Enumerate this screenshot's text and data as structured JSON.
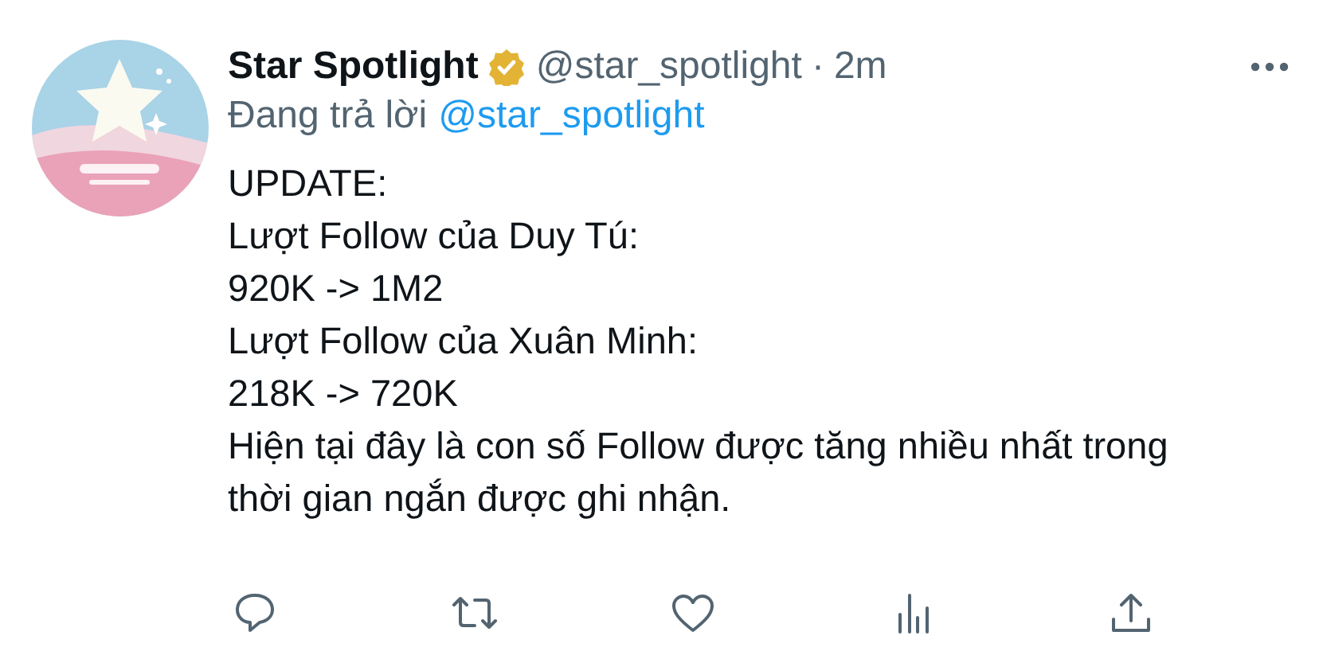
{
  "tweet": {
    "name": "Star Spotlight",
    "verified": true,
    "handle": "@star_spotlight",
    "separator": "·",
    "time": "2m",
    "replying_prefix": "Đang trả lời",
    "replying_to": "@star_spotlight",
    "body": [
      "UPDATE:",
      "Lượt Follow của Duy Tú:",
      "920K -> 1M2",
      "Lượt Follow của Xuân Minh:",
      "218K -> 720K",
      "Hiện tại đây là con số Follow được tăng nhiều nhất trong thời gian ngắn được ghi nhận."
    ]
  }
}
